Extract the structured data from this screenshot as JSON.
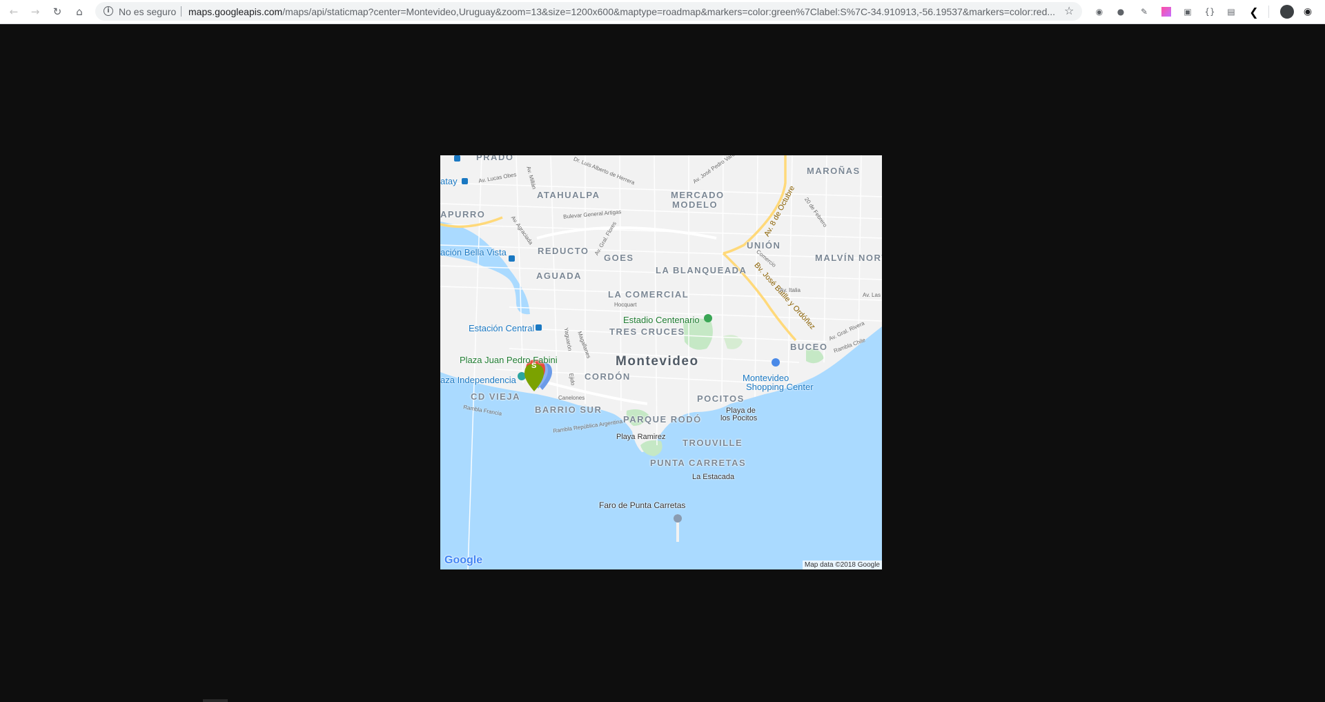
{
  "browser": {
    "security_label": "No es seguro",
    "url_host": "maps.googleapis.com",
    "url_path": "/maps/api/staticmap?center=Montevideo,Uruguay&zoom=13&size=1200x600&maptype=roadmap&markers=color:green%7Clabel:S%7C-34.910913,-56.19537&markers=color:red..."
  },
  "map": {
    "city": "Montevideo",
    "neighborhoods": {
      "prado": "PRADO",
      "atahualpa": "ATAHUALPA",
      "mercado_modelo": "MERCADO MODELO",
      "marona": "MAROÑAS",
      "capurro": "APURRO",
      "reducto": "REDUCTO",
      "union": "UNIÓN",
      "goes": "GOES",
      "aguada": "AGUADA",
      "la_blanqueada": "LA BLANQUEADA",
      "malvin_norte": "MALVÍN NORT",
      "la_comercial": "LA COMERCIAL",
      "tres_cruces": "TRES CRUCES",
      "buceo": "BUCEO",
      "cordon": "CORDÓN",
      "ciudad_vieja": "CD VIEJA",
      "pocitos": "POCITOS",
      "barrio_sur": "BARRIO SUR",
      "parque_rodo": "PARQUE RODÓ",
      "trouville": "TROUVILLE",
      "punta_carretas": "PUNTA CARRETAS"
    },
    "pois": {
      "bella_vista": "ación Bella Vista",
      "estacion_central": "Estación Central",
      "estadio_centenario": "Estadio Centenario",
      "plaza_fabini": "Plaza Juan Pedro Fabini",
      "plaza_independencia": "aza Independencia",
      "montevideo_shopping_l1": "Montevideo",
      "montevideo_shopping_l2": "Shopping Center",
      "playa_pocitos_l1": "Playa de",
      "playa_pocitos_l2": "los Pocitos",
      "playa_ramirez": "Playa Ramirez",
      "la_estacada": "La Estacada",
      "faro": "Faro de Punta Carretas",
      "atay": "atay"
    },
    "streets": {
      "luis_alberto": "Dr. Luis Alberto de Herrera",
      "jose_pedro_varela": "Av. José Pedro Varela",
      "lucas_obes": "Av. Lucas Obes",
      "millan": "Av. Millán",
      "bulevar_artigas": "Bulevar General Artigas",
      "flores": "Av. Gral. Flores",
      "agraciada": "Av. Agraciada",
      "ocho_octubre": "Av. 8 de Octubre",
      "veinte_febrero": "20 de Febrero",
      "comercio": "Comercio",
      "batlle": "Bv. José Batlle y Ordóñez",
      "italia": "Av. Italia",
      "rivera": "Av. Gral. Rivera",
      "rambla_chile": "Rambla Chile",
      "hocquart": "Hocquart",
      "yaguaron": "Yaguarón",
      "magallanes": "Magallanes",
      "ejido": "Ejido",
      "canelones": "Canelones",
      "rambla_francia": "Rambla Francia",
      "rambla_argentina": "Rambla República Argentina",
      "av_las": "Av. Las"
    },
    "marker_label": "S",
    "google_logo": "Google",
    "attribution": "Map data ©2018 Google"
  },
  "colors": {
    "water": "#aadaff",
    "land": "#f2f2f2",
    "park": "#c5e8c5",
    "major_road": "#ffd97a",
    "marker_green": "#7ba200",
    "marker_red": "#e74c3c",
    "marker_blue": "#6b9be8"
  }
}
